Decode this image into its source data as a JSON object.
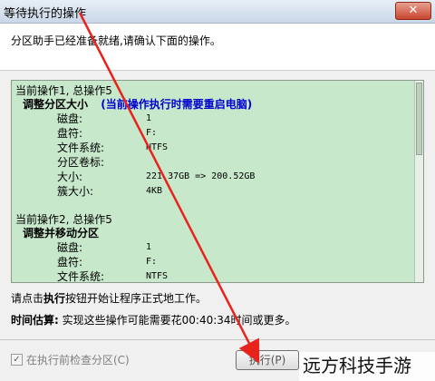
{
  "window": {
    "title": "等待执行的操作",
    "close_glyph": "✕"
  },
  "header": {
    "text": "分区助手已经准备就绪,请确认下面的操作。"
  },
  "operations": [
    {
      "title": "当前操作1, 总操作5",
      "name": "调整分区大小",
      "warning": "(当前操作执行时需要重启电脑)",
      "rows": [
        {
          "k": "磁盘:",
          "v": "1"
        },
        {
          "k": "盘符:",
          "v": "F:"
        },
        {
          "k": "文件系统:",
          "v": "NTFS"
        },
        {
          "k": "分区卷标:",
          "v": ""
        },
        {
          "k": "大小:",
          "v": "221.37GB => 200.52GB"
        },
        {
          "k": "簇大小:",
          "v": "4KB"
        }
      ]
    },
    {
      "title": "当前操作2, 总操作5",
      "name": "调整并移动分区",
      "rows": [
        {
          "k": "磁盘:",
          "v": "1"
        },
        {
          "k": "盘符:",
          "v": "F:"
        },
        {
          "k": "文件系统:",
          "v": "NTFS"
        }
      ]
    }
  ],
  "instructions": {
    "before": "请点击",
    "bold": "执行",
    "after": "按钮开始让程序正式地工作。"
  },
  "time_estimate": {
    "label": "时间估算:",
    "text": "实现这些操作可能需要花00:40:34时间或更多。"
  },
  "footer": {
    "checkbox_label": "在执行前检查分区(C)",
    "checked_glyph": "✓",
    "execute_label": "执行(P)"
  },
  "watermark": {
    "text": "远方科技手游"
  },
  "colors": {
    "arrow": "#e8231e",
    "panel_bg": "#c7e8cb",
    "warning": "#0000d0"
  }
}
